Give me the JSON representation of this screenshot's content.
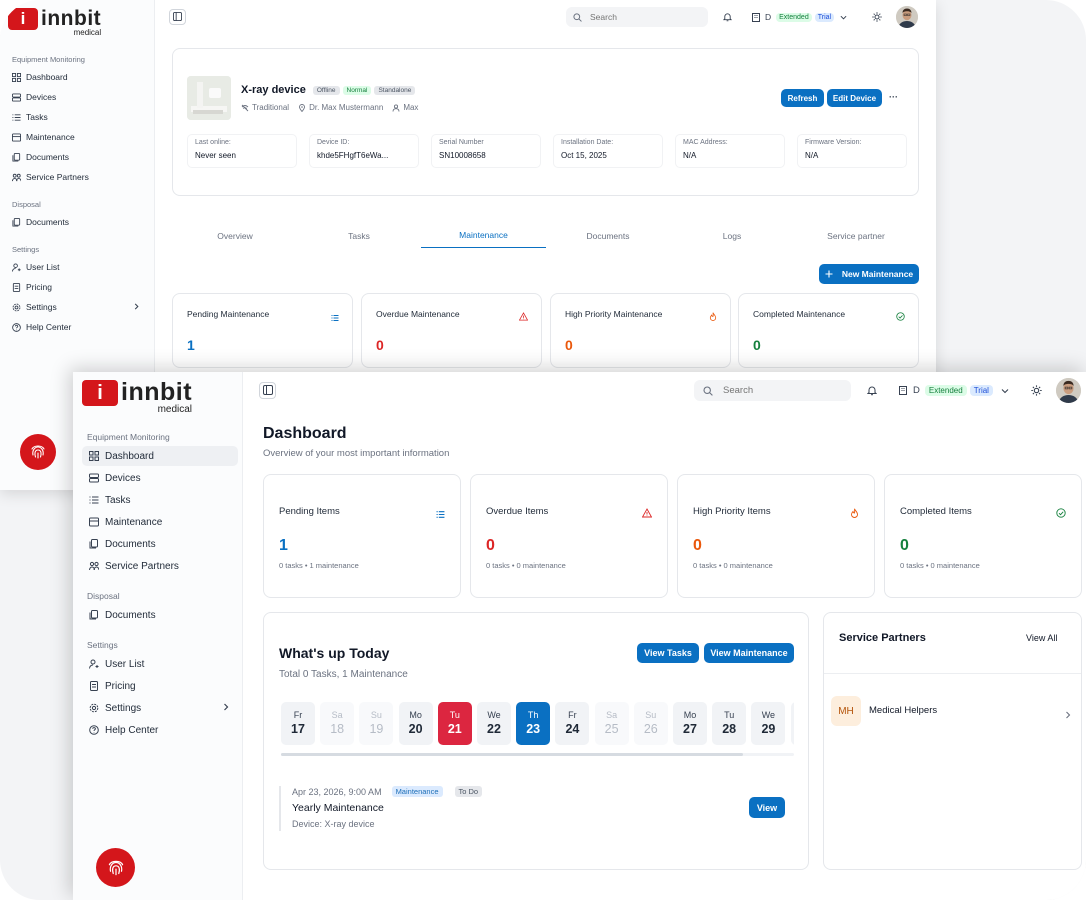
{
  "brand": {
    "name": "innbit",
    "sub": "medical",
    "mark": "i"
  },
  "colors": {
    "accent": "#0a70c2",
    "brand_red": "#d4161b",
    "overdue": "#dc2626",
    "priority": "#ea580c",
    "completed": "#15803d"
  },
  "sidebar": {
    "sections": [
      {
        "label": "Equipment Monitoring",
        "items": [
          {
            "label": "Dashboard",
            "icon": "grid-icon"
          },
          {
            "label": "Devices",
            "icon": "server-icon"
          },
          {
            "label": "Tasks",
            "icon": "list-icon"
          },
          {
            "label": "Maintenance",
            "icon": "wrench-icon"
          },
          {
            "label": "Documents",
            "icon": "documents-icon"
          },
          {
            "label": "Service Partners",
            "icon": "partners-icon"
          }
        ]
      },
      {
        "label": "Disposal",
        "items": [
          {
            "label": "Documents",
            "icon": "documents-icon"
          }
        ]
      },
      {
        "label": "Settings",
        "items": [
          {
            "label": "User List",
            "icon": "user-icon"
          },
          {
            "label": "Pricing",
            "icon": "receipt-icon"
          },
          {
            "label": "Settings",
            "icon": "gear-icon"
          },
          {
            "label": "Help Center",
            "icon": "help-icon"
          }
        ]
      }
    ]
  },
  "topbar": {
    "search_placeholder": "Search",
    "tenant_initial": "D",
    "plan_badge": "Extended",
    "trial_badge": "Trial"
  },
  "device_page": {
    "title": "X-ray device",
    "tags": [
      "Offline",
      "Normal",
      "Standalone"
    ],
    "meta": {
      "type": "Traditional",
      "owner": "Dr. Max Mustermann",
      "user": "Max"
    },
    "buttons": {
      "refresh": "Refresh",
      "edit": "Edit Device",
      "more": "···"
    },
    "fields": [
      {
        "label": "Last online:",
        "value": "Never seen"
      },
      {
        "label": "Device ID:",
        "value": "khde5FHgfT6eWa..."
      },
      {
        "label": "Serial Number",
        "value": "SN10008658"
      },
      {
        "label": "Installation Date:",
        "value": "Oct 15, 2025"
      },
      {
        "label": "MAC Address:",
        "value": "N/A"
      },
      {
        "label": "Firmware Version:",
        "value": "N/A"
      }
    ],
    "tabs": [
      "Overview",
      "Tasks",
      "Maintenance",
      "Documents",
      "Logs",
      "Service partner"
    ],
    "active_tab": "Maintenance",
    "new_button": "New Maintenance",
    "stats": [
      {
        "title": "Pending Maintenance",
        "value": "1"
      },
      {
        "title": "Overdue Maintenance",
        "value": "0"
      },
      {
        "title": "High Priority Maintenance",
        "value": "0"
      },
      {
        "title": "Completed Maintenance",
        "value": "0"
      }
    ]
  },
  "dashboard": {
    "title": "Dashboard",
    "subtitle": "Overview of your most important information",
    "stats": [
      {
        "title": "Pending Items",
        "value": "1",
        "sub": "0 tasks • 1 maintenance"
      },
      {
        "title": "Overdue Items",
        "value": "0",
        "sub": "0 tasks • 0 maintenance"
      },
      {
        "title": "High Priority Items",
        "value": "0",
        "sub": "0 tasks • 0 maintenance"
      },
      {
        "title": "Completed Items",
        "value": "0",
        "sub": "0 tasks • 0 maintenance"
      }
    ],
    "today": {
      "title": "What's up Today",
      "subtitle": "Total 0 Tasks, 1 Maintenance",
      "view_tasks": "View Tasks",
      "view_maintenance": "View Maintenance",
      "days": [
        {
          "name": "Fr",
          "num": "17",
          "state": "normal"
        },
        {
          "name": "Sa",
          "num": "18",
          "state": "weekend"
        },
        {
          "name": "Su",
          "num": "19",
          "state": "weekend"
        },
        {
          "name": "Mo",
          "num": "20",
          "state": "normal"
        },
        {
          "name": "Tu",
          "num": "21",
          "state": "today"
        },
        {
          "name": "We",
          "num": "22",
          "state": "normal"
        },
        {
          "name": "Th",
          "num": "23",
          "state": "selected"
        },
        {
          "name": "Fr",
          "num": "24",
          "state": "normal"
        },
        {
          "name": "Sa",
          "num": "25",
          "state": "weekend"
        },
        {
          "name": "Su",
          "num": "26",
          "state": "weekend"
        },
        {
          "name": "Mo",
          "num": "27",
          "state": "normal"
        },
        {
          "name": "Tu",
          "num": "28",
          "state": "normal"
        },
        {
          "name": "We",
          "num": "29",
          "state": "normal"
        }
      ],
      "event": {
        "datetime": "Apr 23, 2026, 9:00 AM",
        "type_tag": "Maintenance",
        "status_tag": "To Do",
        "title": "Yearly Maintenance",
        "device": "Device: X-ray device",
        "button": "View"
      }
    },
    "partners": {
      "title": "Service Partners",
      "view_all": "View All",
      "items": [
        {
          "initials": "MH",
          "name": "Medical Helpers"
        }
      ]
    }
  }
}
